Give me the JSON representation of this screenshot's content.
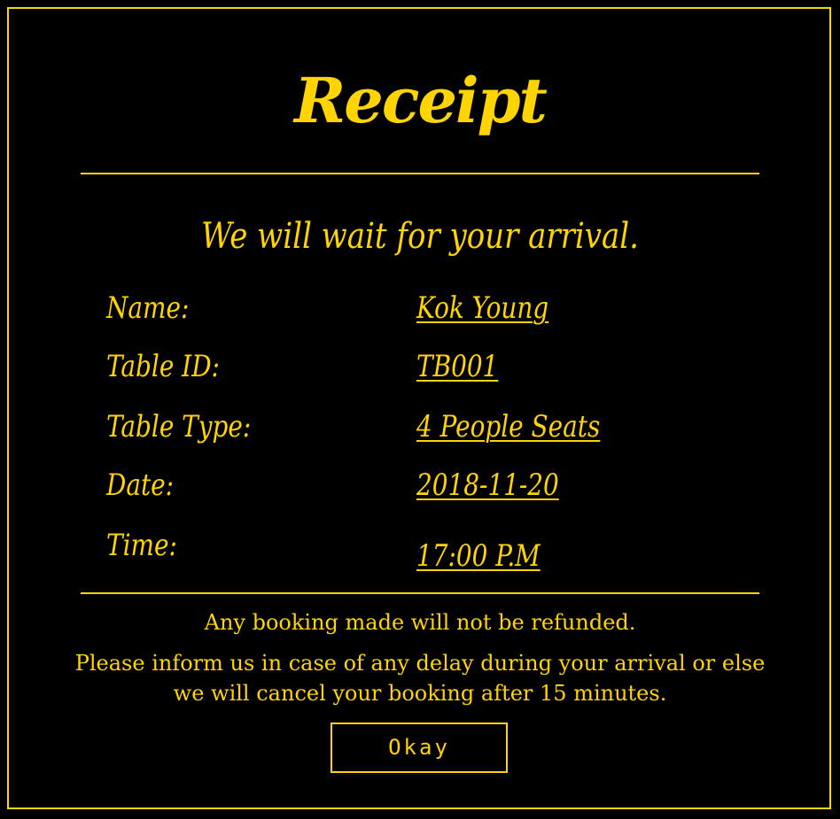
{
  "receipt": {
    "title": "Receipt",
    "subtitle": "We will wait for your arrival.",
    "fields": [
      {
        "label": "Name:",
        "value": "Kok Young"
      },
      {
        "label": "Table ID:",
        "value": "TB001"
      },
      {
        "label": "Table Type:",
        "value": "4 People Seats"
      },
      {
        "label": "Date:",
        "value": "2018-11-20"
      },
      {
        "label": "Time:",
        "value": "17:00 P.M"
      }
    ],
    "notice_refund": "Any booking made will not be refunded.",
    "notice_delay": "Please inform us in case of any delay during your arrival or else we will cancel your booking after 15 minutes.",
    "okay_label": "Okay"
  },
  "colors": {
    "accent": "#FFD400",
    "background": "#000000"
  }
}
